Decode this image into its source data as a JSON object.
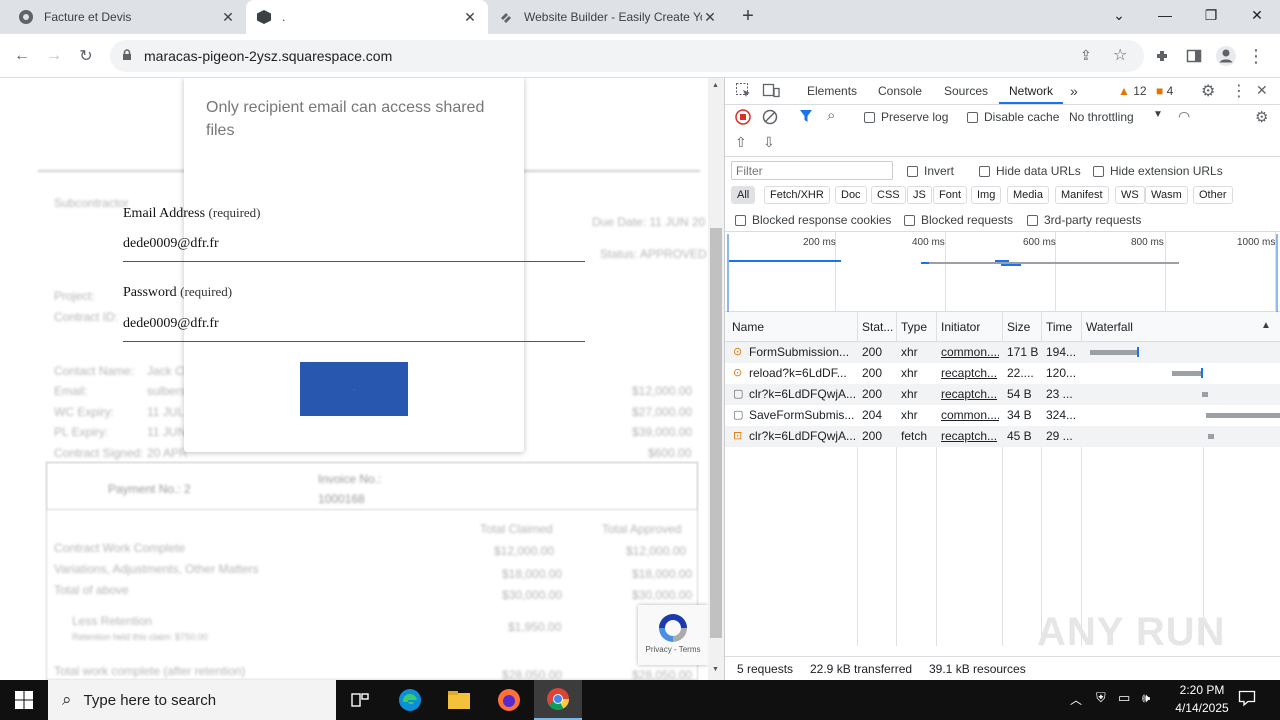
{
  "browser": {
    "tabs": [
      {
        "title": "Facture et Devis",
        "active": false
      },
      {
        "title": ".",
        "active": true
      },
      {
        "title": "Website Builder - Easily Create Yo",
        "active": false
      }
    ],
    "url": "maracas-pigeon-2ysz.squarespace.com"
  },
  "page": {
    "notice": "Only recipient email can access shared files",
    "email_label": "Email Address",
    "email_required": "(required)",
    "email_value": "dede0009@dfr.fr",
    "password_label": "Password",
    "password_required": "(required)",
    "password_value": "dede0009@dfr.fr",
    "submit_label": "·",
    "recaptcha_text": "Privacy - Terms",
    "background": {
      "subcontractor": "Subcontractor",
      "due_date": "Due Date: 11 JUN 20",
      "status": "Status: APPROVED",
      "project": "Project:",
      "contract_id": "Contract ID:",
      "contact_name": "Contact Name:",
      "contact_value": "Jack Cl",
      "email": "Email:",
      "email_value": "sulbers",
      "wc_expiry": "WC Expiry:",
      "wc_value": "11 JUL",
      "pl_expiry": "PL Expiry:",
      "pl_value": "11 JUN",
      "contract_signed": "Contract Signed:",
      "contract_signed_value": "20 APR",
      "amount1": "$12,000.00",
      "amount2": "$27,000.00",
      "amount3": "$39,000.00",
      "amount4": "$600.00",
      "payment_no": "Payment No.: 2",
      "invoice_no": "Invoice No.:",
      "invoice_value": "1000168",
      "total_claimed": "Total Claimed",
      "total_approved": "Total Approved",
      "contract_work": "Contract Work Complete",
      "variations": "Variations, Adjustments, Other Matters",
      "total_above": "Total of above",
      "less_retention": "Less Retention",
      "retention_note": "Retention held this claim: $750.00",
      "total_work": "Total work complete (after retention)",
      "cw_claimed": "$12,000.00",
      "cw_approved": "$12,000.00",
      "var_claimed": "$18,000.00",
      "var_approved": "$18,000.00",
      "tot_claimed": "$30,000.00",
      "tot_approved": "$30,000.00",
      "ret_claimed": "$1,950.00",
      "tw_claimed": "$28,050.00",
      "tw_approved": "$28,050.00"
    }
  },
  "devtools": {
    "tabs": [
      "Elements",
      "Console",
      "Sources",
      "Network"
    ],
    "active_tab": "Network",
    "warnings": "12",
    "errors": "4",
    "preserve_log": "Preserve log",
    "disable_cache": "Disable cache",
    "throttling": "No throttling",
    "filter_placeholder": "Filter",
    "invert": "Invert",
    "hide_data_urls": "Hide data URLs",
    "hide_extension_urls": "Hide extension URLs",
    "type_filters": [
      "All",
      "Fetch/XHR",
      "Doc",
      "CSS",
      "JS",
      "Font",
      "Img",
      "Media",
      "Manifest",
      "WS",
      "Wasm",
      "Other"
    ],
    "blocked_cookies": "Blocked response cookies",
    "blocked_requests": "Blocked requests",
    "third_party": "3rd-party requests",
    "timeline_ticks": [
      "200 ms",
      "400 ms",
      "600 ms",
      "800 ms",
      "1000 ms"
    ],
    "columns": [
      "Name",
      "Stat...",
      "Type",
      "Initiator",
      "Size",
      "Time",
      "Waterfall"
    ],
    "requests": [
      {
        "name": "FormSubmission...",
        "status": "200",
        "type": "xhr",
        "initiator": "common....",
        "size": "171 B",
        "time": "194...",
        "icon": "xhr-icon"
      },
      {
        "name": "reload?k=6LdDF...",
        "status": "200",
        "type": "xhr",
        "initiator": "recaptch...",
        "size": "22....",
        "time": "120...",
        "icon": "xhr-icon"
      },
      {
        "name": "clr?k=6LdDFQwjA...",
        "status": "200",
        "type": "xhr",
        "initiator": "recaptch...",
        "size": "54 B",
        "time": "23 ...",
        "icon": "doc-icon"
      },
      {
        "name": "SaveFormSubmis...",
        "status": "204",
        "type": "xhr",
        "initiator": "common....",
        "size": "34 B",
        "time": "324...",
        "icon": "doc-icon"
      },
      {
        "name": "clr?k=6LdDFQwjA...",
        "status": "200",
        "type": "fetch",
        "initiator": "recaptch...",
        "size": "45 B",
        "time": "29 ...",
        "icon": "fetch-icon"
      }
    ],
    "summary_requests": "5 requests",
    "summary_transferred": "22.9 kB transferred",
    "summary_resources": "39.1 kB resources",
    "watermark": "ANY RUN"
  },
  "taskbar": {
    "search_placeholder": "Type here to search",
    "time": "2:20 PM",
    "date": "4/14/2025"
  }
}
